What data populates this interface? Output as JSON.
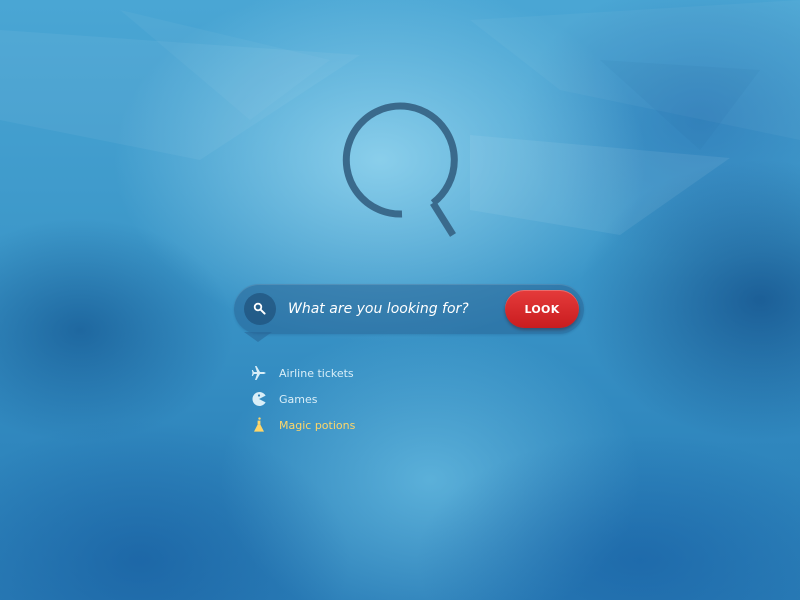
{
  "search": {
    "placeholder": "What are you looking for?",
    "button_label": "LOOK"
  },
  "suggestions": [
    {
      "label": "Airline tickets",
      "icon": "airplane-icon"
    },
    {
      "label": "Games",
      "icon": "pacman-icon"
    },
    {
      "label": "Magic potions",
      "icon": "potion-flask-icon",
      "highlighted": true
    }
  ],
  "colors": {
    "logo": "#3a6a8c",
    "button": "#d42a2c",
    "highlight": "#ffd668",
    "suggestion_text": "#d9eef8"
  }
}
